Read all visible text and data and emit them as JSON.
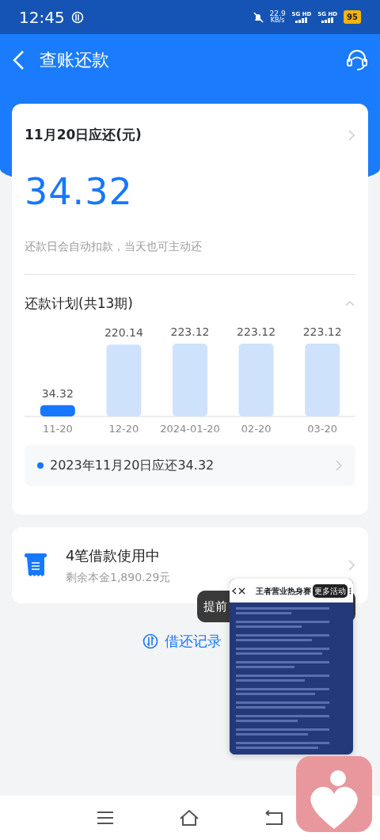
{
  "status_bar": {
    "time": "12:45",
    "net_speed": "22.9",
    "net_unit": "KB/s",
    "sims": [
      "5G HD",
      "5G HD"
    ],
    "battery": "95"
  },
  "header": {
    "title": "查账还款"
  },
  "due_card": {
    "title": "11月20日应还(元)",
    "amount": "34.32",
    "note": "还款日会自动扣款，当天也可主动还"
  },
  "plan": {
    "title": "还款计划(共13期)",
    "expanded": true,
    "chart_data": {
      "type": "bar",
      "categories": [
        "11-20",
        "12-20",
        "2024-01-20",
        "02-20",
        "03-20"
      ],
      "stacked": true,
      "data_labels": true,
      "series": [
        {
          "color": "#1677ff",
          "values": [
            34.32,
            null,
            null,
            null,
            null
          ]
        },
        {
          "color": "#cfe2fb",
          "values": [
            null,
            220.14,
            223.12,
            223.12,
            223.12
          ]
        }
      ]
    },
    "summary": "2023年11月20日应还34.32"
  },
  "loans": {
    "title": "4笔借款使用中",
    "subtitle": "剩余本金1,890.29元"
  },
  "history_link": "借还记录",
  "toast": "提前",
  "floating_window": {
    "title": "王者营业热身赛",
    "badge": "更多活动"
  }
}
